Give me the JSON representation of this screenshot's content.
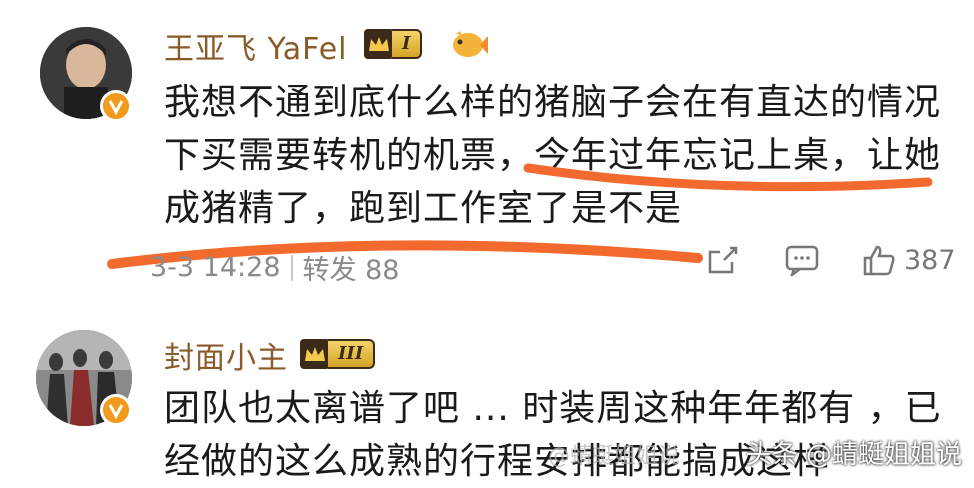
{
  "comments": [
    {
      "username": "王亚飞 YaFel",
      "level": "I",
      "text_lines": [
        "我想不通到底什么样的猪脑子会在有直达的情况",
        "下买需要转机的机票，今年过年忘记上桌，让她",
        "成猪精了，跑到工作室了是不是"
      ],
      "time": "3-3 14:28",
      "repost": "转发 88",
      "like_count": "387"
    },
    {
      "username": "封面小主",
      "level": "III",
      "text_lines": [
        "团队也太离谱了吧 ... 时装周这种年年都有 ，已",
        "经做的这么成熟的行程安排都能搞成这样"
      ]
    }
  ],
  "watermark": "@蜻蜓姐姐说",
  "source": "头条 @蜻蜓姐姐说",
  "colors": {
    "username": "#8a5b2a",
    "verified": "#f19a1e",
    "underline": "#f26a2e"
  },
  "icons": [
    "verified-v-icon",
    "crown-icon",
    "fish-icon",
    "share-icon",
    "comment-icon",
    "like-icon"
  ]
}
